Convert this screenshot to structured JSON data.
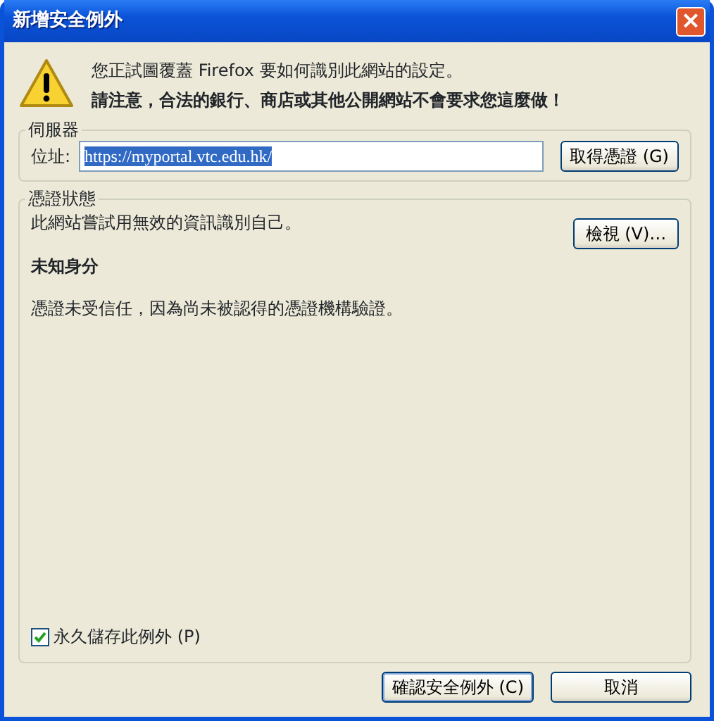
{
  "window": {
    "title": "新增安全例外",
    "close": "×"
  },
  "warning": {
    "line_1": "您正試圖覆蓋 Firefox 要如何識別此網站的設定。",
    "line_2": "請注意，合法的銀行、商店或其他公開網站不會要求您這麼做！"
  },
  "server": {
    "legend": "伺服器",
    "address_label": "位址:",
    "address_value": "https://myportal.vtc.edu.hk/",
    "address_selected": true,
    "button": "取得憑證 (G)"
  },
  "certificate_status": {
    "legend": "憑證狀態",
    "message": "此網站嘗試用無效的資訊識別自己。",
    "view_button": "檢視 (V)…",
    "heading": "未知身分",
    "detail": "憑證未受信任，因為尚未被認得的憑證機構驗證。"
  },
  "permanent": {
    "label": "永久儲存此例外 (P)",
    "checked": true
  },
  "buttons": [
    {
      "label": "確認安全例外 (C)",
      "default": true
    },
    {
      "label": "取消",
      "default": false
    }
  ]
}
